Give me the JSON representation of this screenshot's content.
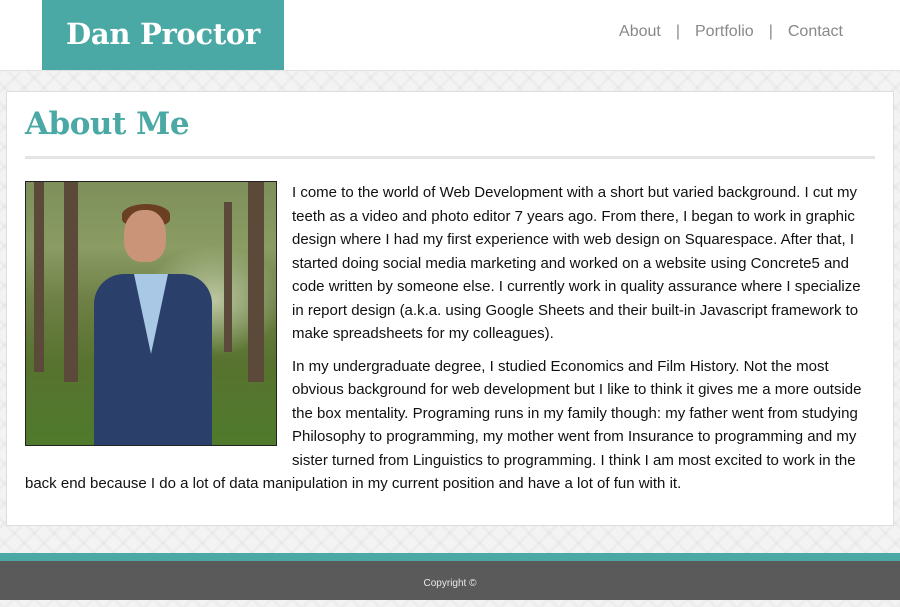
{
  "header": {
    "logo": "Dan Proctor",
    "nav": [
      "About",
      "Portfolio",
      "Contact"
    ],
    "separator": "|"
  },
  "main": {
    "title": "About Me",
    "paragraphs": [
      "I come to the world of Web Development with a short but varied background. I cut my teeth as a video and photo editor 7 years ago. From there, I began to work in graphic design where I had my first experience with web design on Squarespace. After that, I started doing social media marketing and worked on a website using Concrete5 and code written by someone else. I currently work in quality assurance where I specialize in report design (a.k.a. using Google Sheets and their built-in Javascript framework to make spreadsheets for my colleagues).",
      "In my undergraduate degree, I studied Economics and Film History. Not the most obvious background for web development but I like to think it gives me a more outside the box mentality. Programing runs in my family though: my father went from studying Philosophy to programming, my mother went from Insurance to programming and my sister turned from Linguistics to programming. I think I am most excited to work in the back end because I do a lot of data manipulation in my current position and have a lot of fun with it."
    ]
  },
  "footer": {
    "copyright": "Copyright ©"
  },
  "colors": {
    "accent": "#4aa9a4",
    "footer_bg": "#5a5a5a",
    "nav_text": "#888888"
  }
}
